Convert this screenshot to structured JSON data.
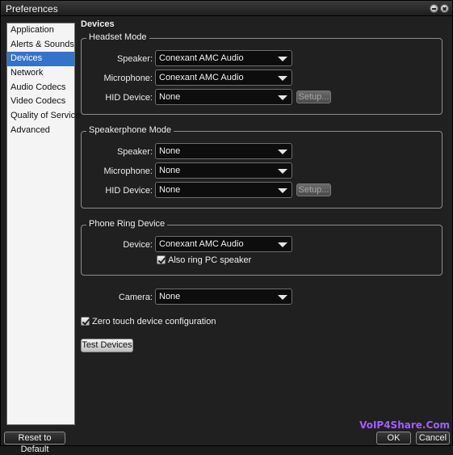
{
  "window": {
    "title": "Preferences"
  },
  "sidebar": {
    "items": [
      {
        "label": "Application"
      },
      {
        "label": "Alerts & Sounds"
      },
      {
        "label": "Devices"
      },
      {
        "label": "Network"
      },
      {
        "label": "Audio Codecs"
      },
      {
        "label": "Video Codecs"
      },
      {
        "label": "Quality of Service"
      },
      {
        "label": "Advanced"
      }
    ],
    "selected": "Devices"
  },
  "content": {
    "title": "Devices",
    "headset": {
      "legend": "Headset Mode",
      "speaker_label": "Speaker:",
      "speaker_value": "Conexant AMC Audio",
      "microphone_label": "Microphone:",
      "microphone_value": "Conexant AMC Audio",
      "hid_label": "HID Device:",
      "hid_value": "None",
      "setup_label": "Setup..."
    },
    "speakerphone": {
      "legend": "Speakerphone Mode",
      "speaker_label": "Speaker:",
      "speaker_value": "None",
      "microphone_label": "Microphone:",
      "microphone_value": "None",
      "hid_label": "HID Device:",
      "hid_value": "None",
      "setup_label": "Setup..."
    },
    "ring": {
      "legend": "Phone Ring Device",
      "device_label": "Device:",
      "device_value": "Conexant AMC Audio",
      "also_ring_label": "Also ring PC speaker",
      "also_ring_checked": true
    },
    "camera_label": "Camera:",
    "camera_value": "None",
    "zero_touch_label": "Zero touch device configuration",
    "zero_touch_checked": true,
    "test_devices_label": "Test Devices"
  },
  "footer": {
    "reset_label": "Reset to Default",
    "ok_label": "OK",
    "cancel_label": "Cancel"
  },
  "watermark": "VoIP4Share.Com"
}
